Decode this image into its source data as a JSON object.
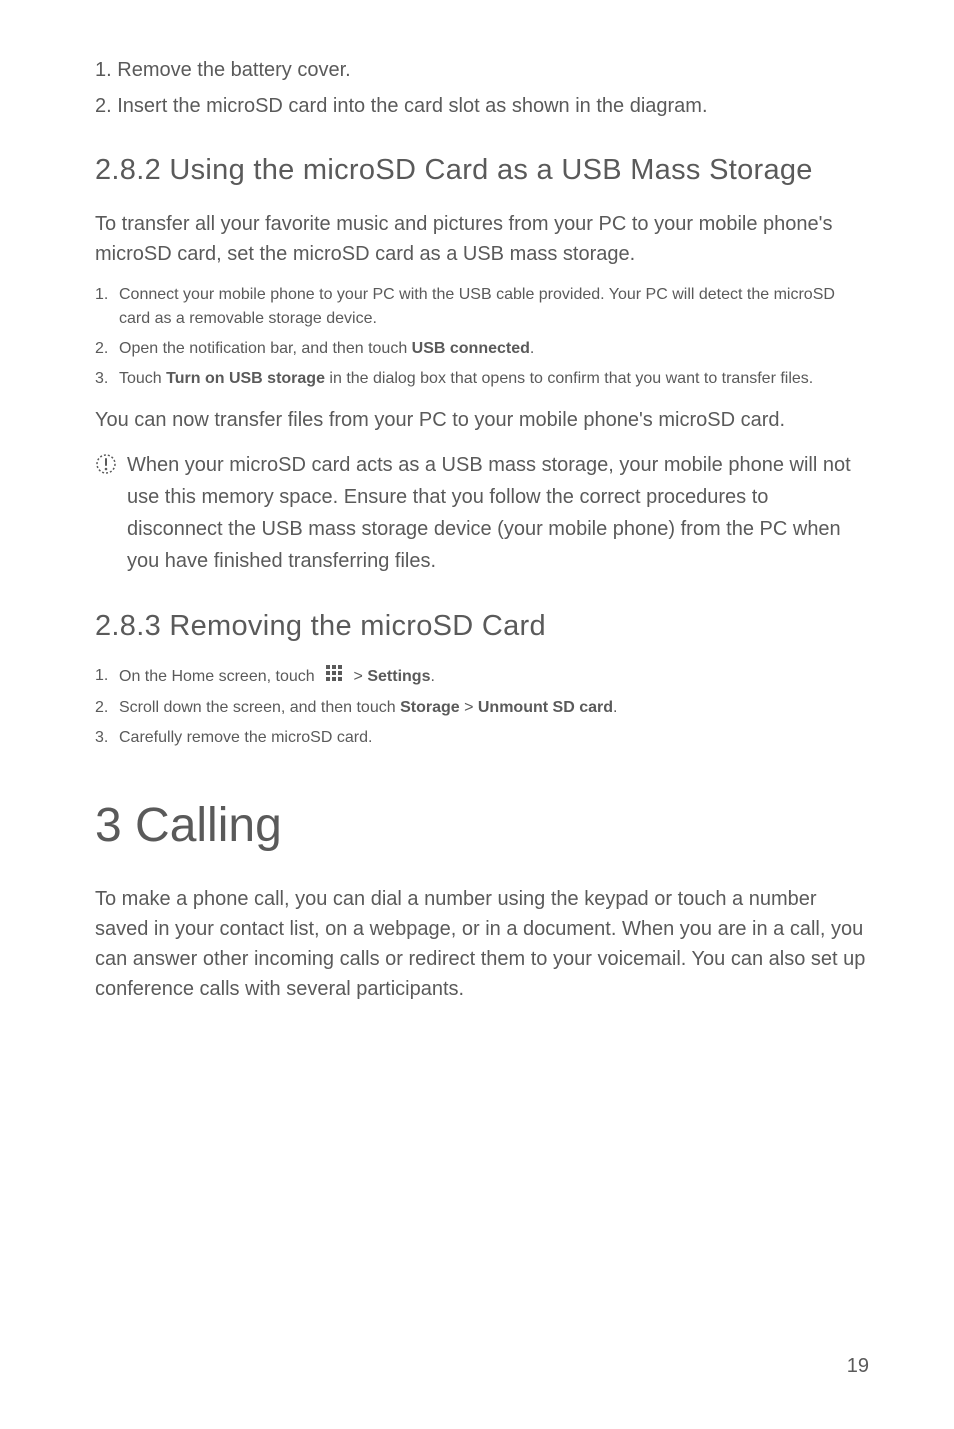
{
  "intro_steps": [
    {
      "num": "1.",
      "text": "Remove the battery cover."
    },
    {
      "num": "2.",
      "text": "Insert the microSD card into the card slot as shown in the diagram."
    }
  ],
  "section1": {
    "heading": "2.8.2  Using the microSD Card as a USB Mass Storage",
    "intro": "To transfer all your favorite music and pictures from your PC to your mobile phone's microSD card, set the microSD card as a USB mass storage.",
    "steps": [
      {
        "num": "1.",
        "parts": [
          {
            "text": "Connect your mobile phone to your PC with the USB cable provided. Your PC will detect the microSD card as a removable storage device.",
            "bold": false
          }
        ]
      },
      {
        "num": "2.",
        "parts": [
          {
            "text": "Open the notification bar, and then touch ",
            "bold": false
          },
          {
            "text": "USB connected",
            "bold": true
          },
          {
            "text": ".",
            "bold": false
          }
        ]
      },
      {
        "num": "3.",
        "parts": [
          {
            "text": "Touch ",
            "bold": false
          },
          {
            "text": "Turn on USB storage",
            "bold": true
          },
          {
            "text": " in the dialog box that opens to confirm that you want to transfer files.",
            "bold": false
          }
        ]
      }
    ],
    "after": "You can now transfer files from your PC to your mobile phone's microSD card.",
    "note": "When your microSD card acts as a USB mass storage, your mobile phone will not use this memory space. Ensure that you follow the correct procedures to disconnect the USB mass storage device (your mobile phone) from the PC when you have finished transferring files."
  },
  "section2": {
    "heading": "2.8.3  Removing the microSD Card",
    "steps": [
      {
        "num": "1.",
        "parts": [
          {
            "text": "On the Home screen, touch ",
            "bold": false
          },
          {
            "icon": "apps"
          },
          {
            "text": "  > ",
            "bold": false
          },
          {
            "text": "Settings",
            "bold": true
          },
          {
            "text": ".",
            "bold": false
          }
        ]
      },
      {
        "num": "2.",
        "parts": [
          {
            "text": "Scroll down the screen, and then touch ",
            "bold": false
          },
          {
            "text": "Storage",
            "bold": true
          },
          {
            "text": " > ",
            "bold": false
          },
          {
            "text": "Unmount SD card",
            "bold": true
          },
          {
            "text": ".",
            "bold": false
          }
        ]
      },
      {
        "num": "3.",
        "parts": [
          {
            "text": "Carefully remove the microSD card.",
            "bold": false
          }
        ]
      }
    ]
  },
  "chapter": {
    "heading": "3  Calling",
    "para": "To make a phone call, you can dial a number using the keypad or touch a number saved in your contact list, on a webpage, or in a document. When you are in a call, you can answer other incoming calls or redirect them to your voicemail. You can also set up conference calls with several participants."
  },
  "page_number": "19"
}
